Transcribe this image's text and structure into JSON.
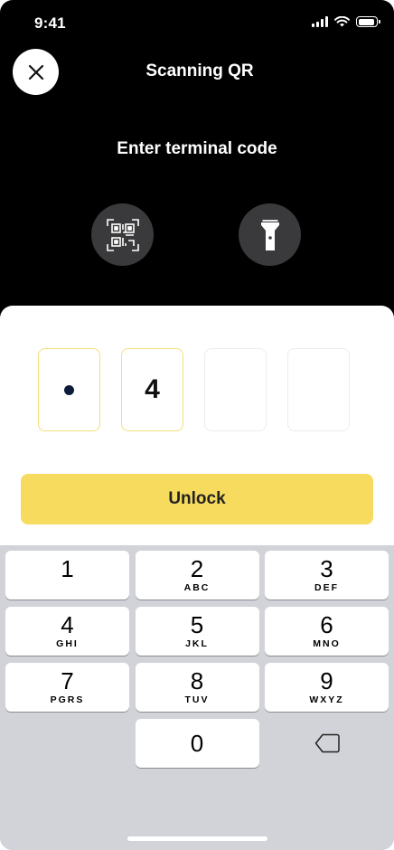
{
  "status_bar": {
    "time": "9:41"
  },
  "header": {
    "title": "Scanning QR",
    "subtitle": "Enter terminal code"
  },
  "icons": {
    "close": "close-icon",
    "qr": "qr-code-icon",
    "flashlight": "flashlight-icon",
    "backspace": "backspace-icon"
  },
  "code": {
    "digits": [
      "•",
      "4",
      "",
      ""
    ]
  },
  "unlock_label": "Unlock",
  "keypad": [
    {
      "num": "1",
      "letters": ""
    },
    {
      "num": "2",
      "letters": "ABC"
    },
    {
      "num": "3",
      "letters": "DEF"
    },
    {
      "num": "4",
      "letters": "GHI"
    },
    {
      "num": "5",
      "letters": "JKL"
    },
    {
      "num": "6",
      "letters": "MNO"
    },
    {
      "num": "7",
      "letters": "PGRS"
    },
    {
      "num": "8",
      "letters": "TUV"
    },
    {
      "num": "9",
      "letters": "WXYZ"
    },
    {
      "num": "0",
      "letters": ""
    }
  ],
  "colors": {
    "accent": "#F7DB5E",
    "dark_bg": "#000000",
    "button_gray": "#3A3A3C",
    "keypad_bg": "#D1D3D9"
  }
}
